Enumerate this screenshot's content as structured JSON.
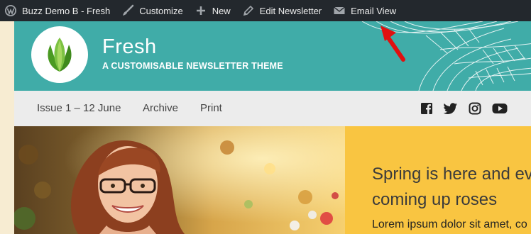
{
  "admin_bar": {
    "site_name": "Buzz Demo B - Fresh",
    "customize": "Customize",
    "new": "New",
    "edit_newsletter": "Edit Newsletter",
    "email_view": "Email View"
  },
  "header": {
    "title": "Fresh",
    "tagline": "A CUSTOMISABLE NEWSLETTER THEME"
  },
  "nav": {
    "issue": "Issue 1  –  12 June",
    "archive": "Archive",
    "print": "Print"
  },
  "hero": {
    "headline_line1": "Spring is here and ev",
    "headline_line2": "coming up roses",
    "body": "Lorem ipsum dolor sit amet, co"
  },
  "colors": {
    "admin_bar": "#23282d",
    "header_teal": "#40aca8",
    "nav_bg": "#ececec",
    "hero_yellow": "#f9c541",
    "annotation_arrow": "#e01010"
  },
  "icons": [
    "wordpress-icon",
    "brush-icon",
    "plus-icon",
    "pencil-icon",
    "envelope-icon",
    "facebook-icon",
    "twitter-icon",
    "instagram-icon",
    "youtube-icon",
    "leaf-logo-icon"
  ]
}
